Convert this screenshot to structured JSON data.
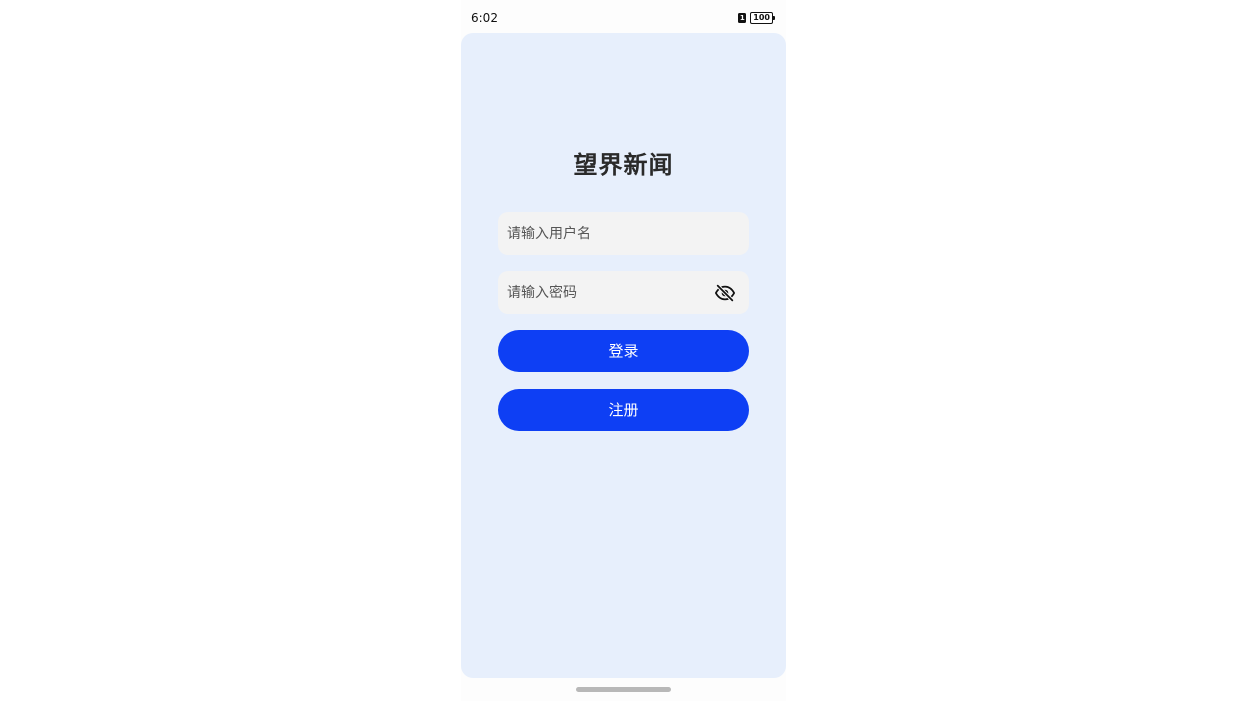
{
  "status_bar": {
    "time": "6:02",
    "sim_label": "1",
    "battery_level": "100"
  },
  "app": {
    "title": "望界新闻"
  },
  "form": {
    "username_placeholder": "请输入用户名",
    "username_value": "",
    "password_placeholder": "请输入密码",
    "password_value": "",
    "password_toggle_icon": "eye-off-icon",
    "login_label": "登录",
    "register_label": "注册"
  },
  "colors": {
    "card_background": "#e7effc",
    "button_primary": "#0e3ff4",
    "input_background": "#f3f3f3",
    "title_text": "#2a2a2a"
  }
}
